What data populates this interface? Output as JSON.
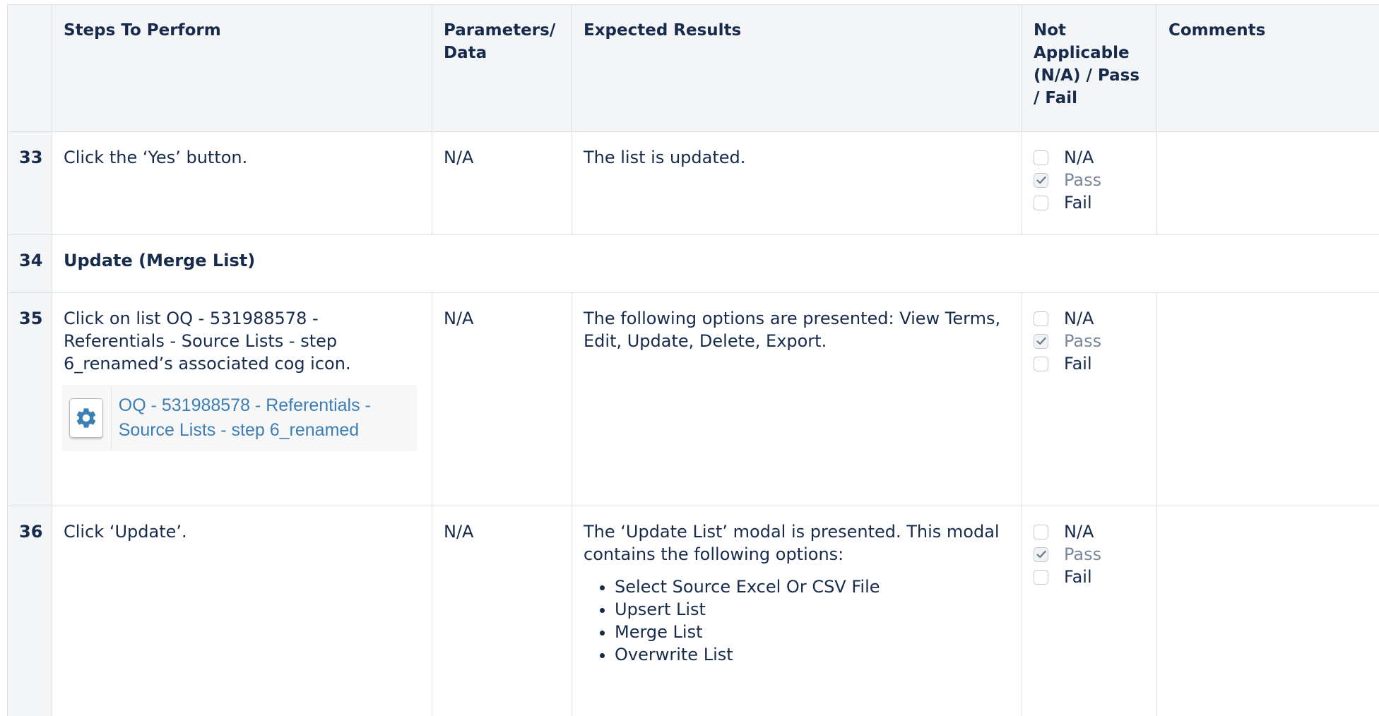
{
  "header": {
    "steps": "Steps To Perform",
    "params": "Parameters/ Data",
    "expected": "Expected Results",
    "status": "Not Applicable (N/A) / Pass / Fail",
    "comments": "Comments"
  },
  "status_options": {
    "na": "N/A",
    "pass": "Pass",
    "fail": "Fail"
  },
  "rows": {
    "r33": {
      "num": "33",
      "step": "Click the ‘Yes’ button.",
      "params": "N/A",
      "expected": "The list is updated.",
      "selected": "Pass"
    },
    "r34": {
      "num": "34",
      "section": "Update (Merge List)"
    },
    "r35": {
      "num": "35",
      "step": "Click on list OQ - 531988578 - Referentials - Source Lists - step 6_renamed’s associated cog icon.",
      "embed_link": "OQ - 531988578 - Referentials - Source Lists - step 6_renamed",
      "params": "N/A",
      "expected": "The following options are presented: View Terms, Edit, Update, Delete, Export.",
      "selected": "Pass"
    },
    "r36": {
      "num": "36",
      "step": "Click ‘Update’.",
      "params": "N/A",
      "expected": "The ‘Update List’ modal is presented. This modal contains the following options:",
      "bullets": [
        "Select Source Excel Or CSV File",
        "Upsert List",
        "Merge List",
        "Overwrite List"
      ],
      "selected": "Pass"
    }
  },
  "colors": {
    "header_bg": "#f4f5f7",
    "border": "#dcdfe4",
    "link": "#3b7fb6",
    "text": "#172b4d",
    "muted": "#7a869a"
  },
  "icons": {
    "embed_button": "cog-icon",
    "checked_box": "checkmark-icon"
  }
}
